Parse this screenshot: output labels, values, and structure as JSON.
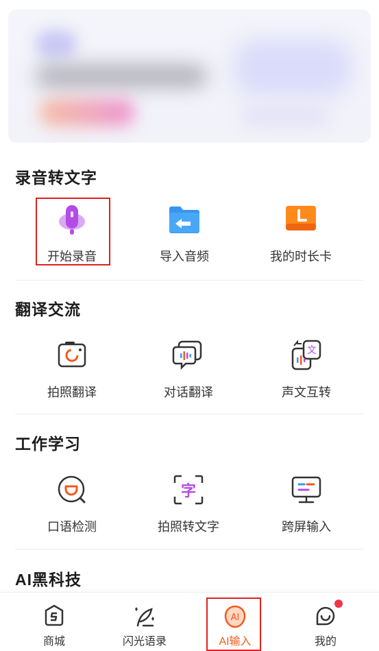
{
  "sections": {
    "record": {
      "title": "录音转文字",
      "items": [
        {
          "label": "开始录音",
          "icon": "microphone-icon"
        },
        {
          "label": "导入音频",
          "icon": "folder-import-icon"
        },
        {
          "label": "我的时长卡",
          "icon": "clock-card-icon"
        }
      ]
    },
    "translate": {
      "title": "翻译交流",
      "items": [
        {
          "label": "拍照翻译",
          "icon": "camera-translate-icon"
        },
        {
          "label": "对话翻译",
          "icon": "dialogue-translate-icon"
        },
        {
          "label": "声文互转",
          "icon": "voice-text-convert-icon"
        }
      ]
    },
    "work": {
      "title": "工作学习",
      "items": [
        {
          "label": "口语检测",
          "icon": "speech-check-icon"
        },
        {
          "label": "拍照转文字",
          "icon": "photo-to-text-icon"
        },
        {
          "label": "跨屏输入",
          "icon": "cross-screen-input-icon"
        }
      ]
    },
    "ai": {
      "title": "AI黑科技"
    }
  },
  "tabbar": {
    "items": [
      {
        "label": "商城",
        "icon": "store-icon",
        "active": false
      },
      {
        "label": "闪光语录",
        "icon": "quill-sparkle-icon",
        "active": false
      },
      {
        "label": "AI输入",
        "icon": "ai-input-icon",
        "active": true
      },
      {
        "label": "我的",
        "icon": "profile-face-icon",
        "active": false,
        "badge": true
      }
    ]
  },
  "colors": {
    "accent": "#f25a1c",
    "highlight": "#e0201c",
    "mic": "#b44be6"
  }
}
